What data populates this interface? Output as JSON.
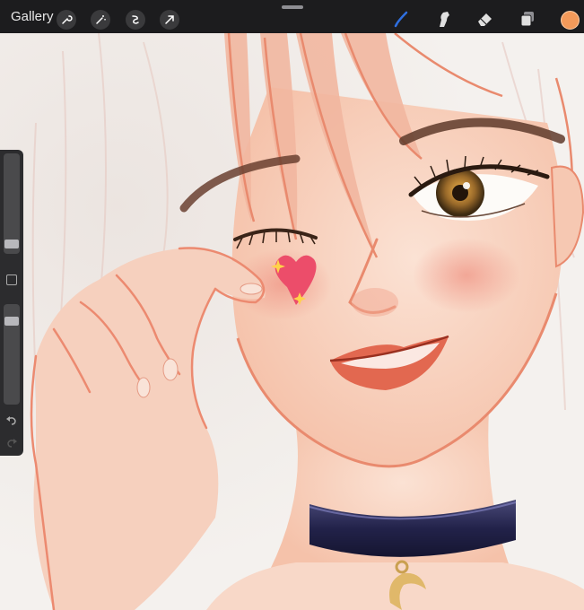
{
  "topbar": {
    "gallery_label": "Gallery",
    "left_tools": [
      "wrench-icon",
      "magic-wand-icon",
      "selection-icon",
      "transform-icon"
    ],
    "right_tools": [
      "brush-icon",
      "smudge-icon",
      "eraser-icon",
      "layers-icon"
    ],
    "active_color": "#f39a5a",
    "brush_color": "#2f6fe0"
  },
  "sidebar": {
    "controls": [
      "brush-size-slider",
      "modify-button",
      "opacity-slider",
      "undo-button",
      "redo-button"
    ]
  }
}
